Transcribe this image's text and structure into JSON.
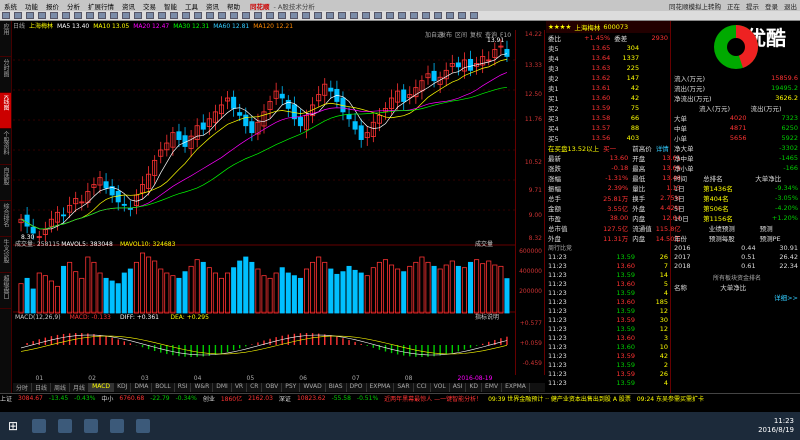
{
  "menubar": {
    "items": [
      "系统",
      "功能",
      "报价",
      "分析",
      "扩展行情",
      "资讯",
      "交易",
      "智能",
      "工具",
      "资讯",
      "帮助"
    ],
    "logo": "同花顺",
    "title": "- A股技术分析",
    "right": [
      "同花顺模拟上转购",
      "正在",
      "提示",
      "登录",
      "退出"
    ]
  },
  "watermark": "优酷",
  "left_tabs": [
    "应用",
    "分时图",
    "K线图",
    "个股资料",
    "自选股",
    "综合排名",
    "牛叉诊股",
    "超级盘口"
  ],
  "kline": {
    "title": [
      "日线",
      "上海梅林",
      "MA5 13.40",
      "MA10 13.05",
      "MA20 12.47",
      "MA30 12.31",
      "MA60 12.81",
      "MA120 12.21"
    ],
    "right": [
      "加自选",
      "发布",
      "区间",
      "复权",
      "查询",
      "F10"
    ],
    "high_label": "13.91",
    "low_label": "8.30",
    "yticks": [
      "14.22",
      "13.33",
      "12.50",
      "11.76",
      "10.52",
      "9.71",
      "9.00",
      "8.32"
    ]
  },
  "volume": {
    "title": [
      "成交量: 258115",
      "MAVOL5: 383048",
      "MAVOL10: 324683"
    ],
    "tag": "成交量",
    "yticks": [
      "600000",
      "400000",
      "200000"
    ]
  },
  "macd": {
    "title": [
      "MACD(12,26,9)",
      "MACD: -0.133",
      "DIFF: +0.361",
      "DEA: +0.295"
    ],
    "tag": "指标说明",
    "yticks": [
      "+0.577",
      "+0.059",
      "-0.459"
    ]
  },
  "xaxis": [
    "01",
    "02",
    "03",
    "04",
    "05",
    "06",
    "07",
    "08"
  ],
  "x_date": "2016-08-19",
  "bottom_tabs": [
    "分时",
    "日线",
    "周线",
    "月线",
    "MACD",
    "KDJ",
    "DMA",
    "BOLL",
    "RSI",
    "W&R",
    "DMI",
    "VR",
    "CR",
    "OBV",
    "PSY",
    "WVAD",
    "BIAS",
    "DPO",
    "EXPMA",
    "SAR",
    "CCI",
    "VOL",
    "ASI",
    "KD",
    "EMV",
    "EXPMA"
  ],
  "quote": {
    "stars": "★★★★",
    "name": "上海梅林",
    "code": "600073",
    "webi": "委比",
    "webi_v": "+1.45%",
    "weicha": "委差",
    "weicha_v": "2930",
    "sell": [
      [
        "5",
        "13.65",
        "304"
      ],
      [
        "4",
        "13.64",
        "1337"
      ],
      [
        "3",
        "13.63",
        "225"
      ],
      [
        "2",
        "13.62",
        "147"
      ],
      [
        "1",
        "13.61",
        "42"
      ]
    ],
    "buy": [
      [
        "1",
        "13.60",
        "42"
      ],
      [
        "2",
        "13.59",
        "75"
      ],
      [
        "3",
        "13.58",
        "66"
      ],
      [
        "4",
        "13.57",
        "88"
      ],
      [
        "5",
        "13.56",
        "403"
      ]
    ],
    "stats": [
      [
        "最新",
        "13.60",
        "开盘",
        "13.61"
      ],
      [
        "涨跌",
        "-0.18",
        "最高",
        "13.69"
      ],
      [
        "涨幅",
        "-1.31%",
        "最低",
        "13.48"
      ],
      [
        "振幅",
        "2.39%",
        "量比",
        "1.15"
      ],
      [
        "总手",
        "25.81万",
        "换手",
        "2.75%"
      ],
      [
        "金额",
        "3.55亿",
        "外盘",
        "4.42%"
      ],
      [
        "市盈",
        "38.00",
        "内盘",
        "12.64"
      ],
      [
        "总市值",
        "127.5亿",
        "流通值",
        "115.8亿"
      ],
      [
        "外盘",
        "11.31万",
        "内盘",
        "14.50万"
      ]
    ],
    "bar": [
      "在买盘13.52以上",
      "买一",
      "前高价",
      "详情"
    ],
    "ticks": [
      [
        "11:23",
        "13.59",
        "26"
      ],
      [
        "11:23",
        "13.60",
        "7"
      ],
      [
        "11:23",
        "13.59",
        "14"
      ],
      [
        "11:23",
        "13.60",
        "5"
      ],
      [
        "11:23",
        "13.59",
        "4"
      ],
      [
        "11:23",
        "13.60",
        "185"
      ],
      [
        "11:23",
        "13.59",
        "12"
      ],
      [
        "11:23",
        "13.59",
        "30"
      ],
      [
        "11:23",
        "13.59",
        "12"
      ],
      [
        "11:23",
        "13.60",
        "3"
      ],
      [
        "11:23",
        "13.60",
        "10"
      ],
      [
        "11:23",
        "13.59",
        "42"
      ],
      [
        "11:23",
        "13.59",
        "2"
      ],
      [
        "11:23",
        "13.59",
        "26"
      ],
      [
        "11:23",
        "13.59",
        "4"
      ]
    ],
    "ticks_hdr": "周行比竞"
  },
  "fund": {
    "legend": [
      [
        "流入(万元)",
        "15859.6"
      ],
      [
        "流出(万元)",
        "19495.2"
      ]
    ],
    "net": [
      "净流出(万元)",
      "3626.2"
    ],
    "table_hdr": [
      "",
      "流入(万元)",
      "流出(万元)"
    ],
    "flow": [
      [
        "大单",
        "4020",
        "7323"
      ],
      [
        "中单",
        "4871",
        "6250"
      ],
      [
        "小单",
        "5656",
        "5922"
      ]
    ],
    "net_rows": [
      [
        "净大单",
        "-3302"
      ],
      [
        "净中单",
        "-1465"
      ],
      [
        "净小单",
        "-166"
      ]
    ],
    "rank_hdr": [
      "时间",
      "总排名",
      "大单净比"
    ],
    "rank": [
      [
        "1日",
        "第1436名",
        "-9.34%"
      ],
      [
        "3日",
        "第404名",
        "-3.05%"
      ],
      [
        "5日",
        "第506名",
        "-4.20%"
      ],
      [
        "10日",
        "第1156名",
        "+1.20%"
      ]
    ],
    "pred_hdr": [
      "",
      "业绩预测",
      "预测"
    ],
    "pred_sub": [
      "年份",
      "预测每股",
      "预测PE"
    ],
    "pred": [
      [
        "2016",
        "0.44",
        "30.91"
      ],
      [
        "2017",
        "0.51",
        "26.42"
      ],
      [
        "2018",
        "0.61",
        "22.34"
      ]
    ],
    "rank2_ttl": "所有板块资金排名",
    "rank2_hdr": [
      "名称",
      "大单净比"
    ],
    "more": "详细>>"
  },
  "status": {
    "items": [
      [
        "上证",
        "3084.67",
        "-13.45",
        "-0.43%"
      ],
      [
        "中小",
        "6760.68",
        "-22.79",
        "-0.34%"
      ],
      [
        "创业",
        "1860亿",
        "",
        "2162.03"
      ],
      [
        "深证",
        "10823.62",
        "-55.58",
        "-0.51%"
      ]
    ],
    "ticker": "近两年黑幕最惊人 —一键智能分析！",
    "ticker2": "09:39 世界金融预计 ·· 健产业资本出售出到股 A 股票",
    "ticker3": "09:24 东吴参需买需扩卡"
  },
  "clock": {
    "time": "11:23",
    "date": "2016/8/19"
  },
  "colors": {
    "up": "#ff3333",
    "down": "#00c0ff",
    "ma5": "#ffffff",
    "ma10": "#ffff00",
    "ma20": "#ff00ff",
    "ma30": "#00ff00"
  },
  "chart_data": {
    "type": "candlestick",
    "closes": [
      8.9,
      8.7,
      8.5,
      8.4,
      8.6,
      8.9,
      9.1,
      9.0,
      9.3,
      9.5,
      9.4,
      9.7,
      9.9,
      10.1,
      9.8,
      9.6,
      9.4,
      9.3,
      9.2,
      9.6,
      9.9,
      10.2,
      10.6,
      10.9,
      11.1,
      11.4,
      11.2,
      11.0,
      11.3,
      11.6,
      11.5,
      11.8,
      12.0,
      12.2,
      12.4,
      12.1,
      11.9,
      11.6,
      11.4,
      11.7,
      12.0,
      12.3,
      12.6,
      12.4,
      12.1,
      11.8,
      11.6,
      11.9,
      12.2,
      12.5,
      12.8,
      12.6,
      12.3,
      12.0,
      11.8,
      11.5,
      11.2,
      11.4,
      11.7,
      11.9,
      12.1,
      12.4,
      12.6,
      12.3,
      12.5,
      12.7,
      12.9,
      13.1,
      12.9,
      13.0,
      13.2,
      13.4,
      13.3,
      13.5,
      13.2,
      13.4,
      13.6,
      13.5,
      13.8,
      13.9,
      13.6
    ],
    "volumes": [
      220,
      260,
      180,
      300,
      280,
      240,
      200,
      350,
      380,
      310,
      260,
      420,
      380,
      300,
      260,
      240,
      220,
      300,
      330,
      380,
      450,
      420,
      390,
      330,
      300,
      280,
      260,
      310,
      350,
      400,
      380,
      340,
      300,
      260,
      300,
      340,
      390,
      420,
      380,
      330,
      280,
      260,
      300,
      340,
      300,
      280,
      260,
      330,
      380,
      420,
      380,
      330,
      290,
      310,
      350,
      320,
      300,
      280,
      340,
      380,
      400,
      360,
      330,
      310,
      350,
      380,
      420,
      380,
      350,
      330,
      360,
      390,
      350,
      340,
      380,
      400,
      370,
      390,
      360,
      350,
      258
    ],
    "ylim": [
      8.3,
      14.22
    ]
  }
}
